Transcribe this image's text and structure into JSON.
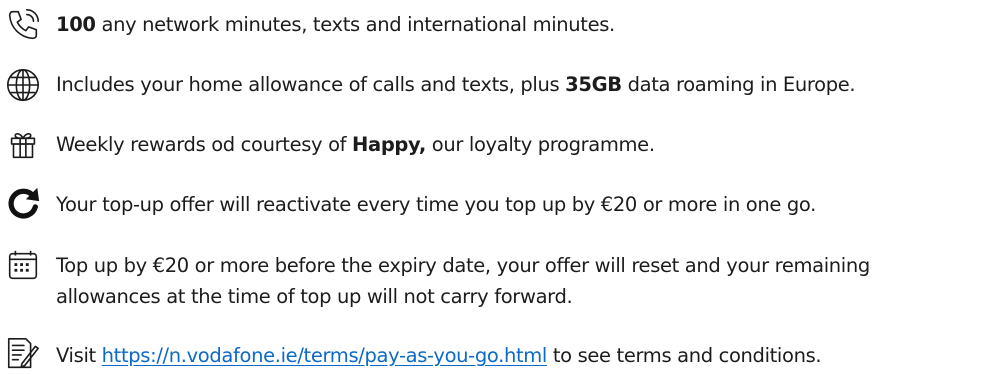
{
  "items": [
    {
      "icon": "phone-calling-icon",
      "bold": "100",
      "after": " any network minutes, texts and international minutes."
    },
    {
      "icon": "globe-icon",
      "before": "Includes your home allowance of calls and texts, plus ",
      "bold": "35GB",
      "after": " data roaming in Europe."
    },
    {
      "icon": "gift-icon",
      "before": "Weekly rewards od courtesy of ",
      "bold": "Happy,",
      "after": " our loyalty programme."
    },
    {
      "icon": "refresh-icon",
      "text": "Your top-up offer will reactivate every time you top up by €20 or more in one go."
    },
    {
      "icon": "calendar-icon",
      "line1": "Top up by €20 or more before the expiry date, your offer will reset and your remaining",
      "line2": "allowances at the time of top up will not carry forward."
    },
    {
      "icon": "document-pen-icon",
      "before": "Visit ",
      "link": "https://n.vodafone.ie/terms/pay-as-you-go.html",
      "after": " to see terms and conditions."
    }
  ],
  "colors": {
    "text": "#1c1c1c",
    "link": "#0b69c7"
  }
}
